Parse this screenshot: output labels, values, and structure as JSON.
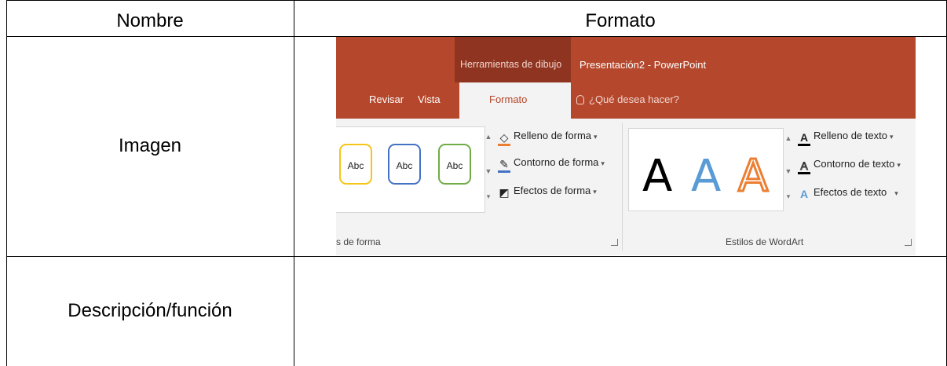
{
  "table": {
    "header_name": "Nombre",
    "header_format": "Formato",
    "row_image_label": "Imagen",
    "row_description_label": "Descripción/función",
    "row_description_value": ""
  },
  "powerpoint": {
    "context_tab_title": "Herramientas de dibujo",
    "document_title": "Presentación2 - PowerPoint",
    "tabs": {
      "revisar": "Revisar",
      "vista": "Vista",
      "formato": "Formato"
    },
    "tell_me": "¿Qué desea hacer?",
    "accent_color": "#b5472c",
    "shape_styles": {
      "items": [
        {
          "label": "Abc",
          "border_color": "#f5c518"
        },
        {
          "label": "Abc",
          "border_color": "#4472c4"
        },
        {
          "label": "Abc",
          "border_color": "#70ad47"
        }
      ],
      "commands": {
        "fill": "Relleno de forma",
        "outline": "Contorno de forma",
        "effects": "Efectos de forma"
      },
      "group_label": "s de forma"
    },
    "wordart": {
      "letters": [
        {
          "label": "A",
          "style": "black"
        },
        {
          "label": "A",
          "style": "blue"
        },
        {
          "label": "A",
          "style": "orange-outline"
        }
      ],
      "commands": {
        "text_fill": "Relleno de texto",
        "text_outline": "Contorno de texto",
        "text_effects": "Efectos de texto"
      },
      "group_label": "Estilos de WordArt"
    }
  }
}
